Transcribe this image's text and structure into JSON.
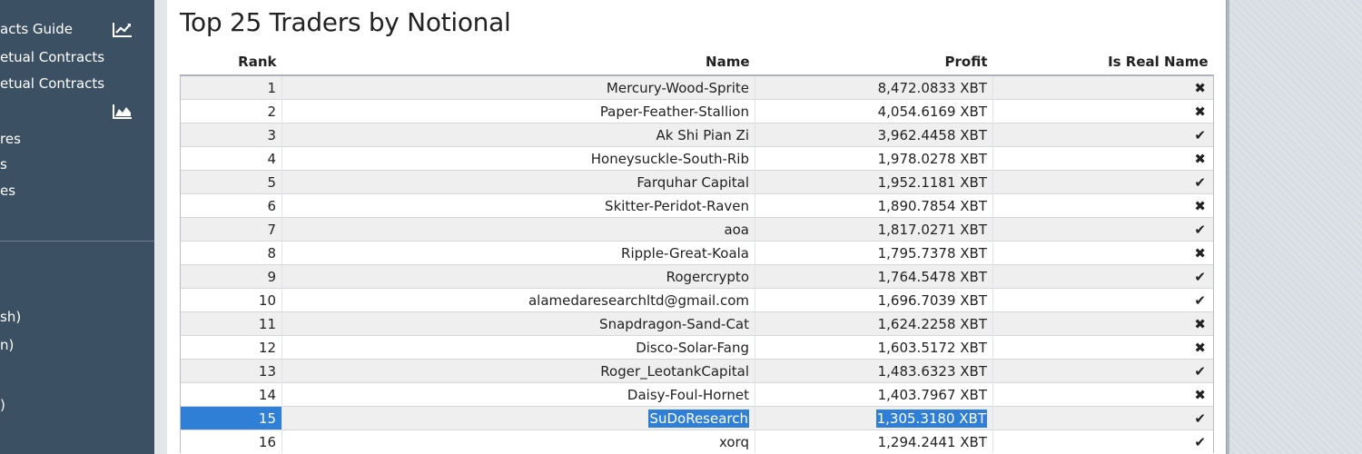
{
  "sidebar": {
    "items": [
      {
        "label": "acts Guide",
        "icon": "line-chart-icon"
      },
      {
        "label": "etual Contracts"
      },
      {
        "label": "etual Contracts"
      },
      {
        "label": "",
        "icon": "area-chart-icon"
      },
      {
        "label": "res"
      },
      {
        "label": "s"
      },
      {
        "label": "es"
      },
      {
        "label": "sh)"
      },
      {
        "label": "n)"
      },
      {
        "label": ")"
      }
    ]
  },
  "main": {
    "title": "Top 25 Traders by Notional",
    "columns": [
      "Rank",
      "Name",
      "Profit",
      "Is Real Name"
    ],
    "rows": [
      {
        "rank": "1",
        "name": "Mercury-Wood-Sprite",
        "profit": "8,472.0833 XBT",
        "real": "✖"
      },
      {
        "rank": "2",
        "name": "Paper-Feather-Stallion",
        "profit": "4,054.6169 XBT",
        "real": "✖"
      },
      {
        "rank": "3",
        "name": "Ak Shi Pian Zi",
        "profit": "3,962.4458 XBT",
        "real": "✔"
      },
      {
        "rank": "4",
        "name": "Honeysuckle-South-Rib",
        "profit": "1,978.0278 XBT",
        "real": "✖"
      },
      {
        "rank": "5",
        "name": "Farquhar Capital",
        "profit": "1,952.1181 XBT",
        "real": "✔"
      },
      {
        "rank": "6",
        "name": "Skitter-Peridot-Raven",
        "profit": "1,890.7854 XBT",
        "real": "✖"
      },
      {
        "rank": "7",
        "name": "aoa",
        "profit": "1,817.0271 XBT",
        "real": "✔"
      },
      {
        "rank": "8",
        "name": "Ripple-Great-Koala",
        "profit": "1,795.7378 XBT",
        "real": "✖"
      },
      {
        "rank": "9",
        "name": "Rogercrypto",
        "profit": "1,764.5478 XBT",
        "real": "✔"
      },
      {
        "rank": "10",
        "name": "alamedaresearchltd@gmail.com",
        "profit": "1,696.7039 XBT",
        "real": "✔"
      },
      {
        "rank": "11",
        "name": "Snapdragon-Sand-Cat",
        "profit": "1,624.2258 XBT",
        "real": "✖"
      },
      {
        "rank": "12",
        "name": "Disco-Solar-Fang",
        "profit": "1,603.5172 XBT",
        "real": "✖"
      },
      {
        "rank": "13",
        "name": "Roger_LeotankCapital",
        "profit": "1,483.6323 XBT",
        "real": "✔"
      },
      {
        "rank": "14",
        "name": "Daisy-Foul-Hornet",
        "profit": "1,403.7967 XBT",
        "real": "✖"
      },
      {
        "rank": "15",
        "name": "SuDoResearch",
        "profit": "1,305.3180 XBT",
        "real": "✔"
      },
      {
        "rank": "16",
        "name": "xorq",
        "profit": "1,294.2441 XBT",
        "real": "✔"
      }
    ],
    "selected_row": "15"
  },
  "colors": {
    "sidebar_bg": "#3c5063",
    "selection": "#2f7fd7",
    "row_stripe": "#efefef"
  }
}
